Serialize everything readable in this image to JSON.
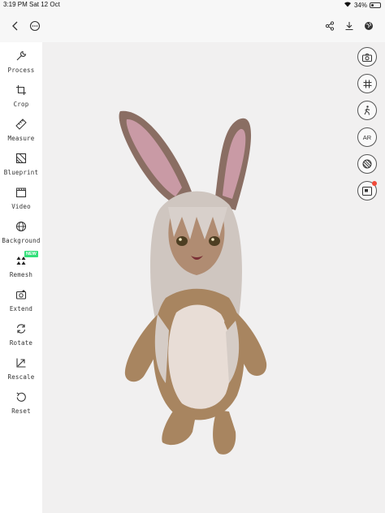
{
  "status": {
    "time": "3:19 PM",
    "date": "Sat 12 Oct",
    "battery": "34%",
    "battery_level": 0.34
  },
  "top_bar": {
    "left_icons": [
      "back-chevron-icon",
      "more-options-icon"
    ],
    "right_icons": [
      "share-icon",
      "download-icon",
      "globe-icon"
    ]
  },
  "sidebar": {
    "items": [
      {
        "label": "Process",
        "icon": "wrench-icon"
      },
      {
        "label": "Crop",
        "icon": "crop-icon"
      },
      {
        "label": "Measure",
        "icon": "ruler-icon"
      },
      {
        "label": "Blueprint",
        "icon": "blueprint-icon"
      },
      {
        "label": "Video",
        "icon": "clapperboard-icon"
      },
      {
        "label": "Background",
        "icon": "globe-icon"
      },
      {
        "label": "Remesh",
        "icon": "remesh-icon",
        "badge": "NEW"
      },
      {
        "label": "Extend",
        "icon": "extend-camera-icon"
      },
      {
        "label": "Rotate",
        "icon": "rotate-icon"
      },
      {
        "label": "Rescale",
        "icon": "rescale-icon"
      },
      {
        "label": "Reset",
        "icon": "reset-icon"
      }
    ]
  },
  "right_toolbar": {
    "buttons": [
      {
        "icon": "camera-icon"
      },
      {
        "icon": "grid-icon"
      },
      {
        "icon": "person-walk-icon"
      },
      {
        "icon": "ar-icon",
        "label": "AR"
      },
      {
        "icon": "texture-sphere-icon"
      },
      {
        "icon": "picture-in-picture-icon",
        "notification": true
      }
    ]
  },
  "colors": {
    "accent_new": "#33e07a",
    "notification": "#f04a3a",
    "viewport_bg": "#f1f0f0"
  }
}
